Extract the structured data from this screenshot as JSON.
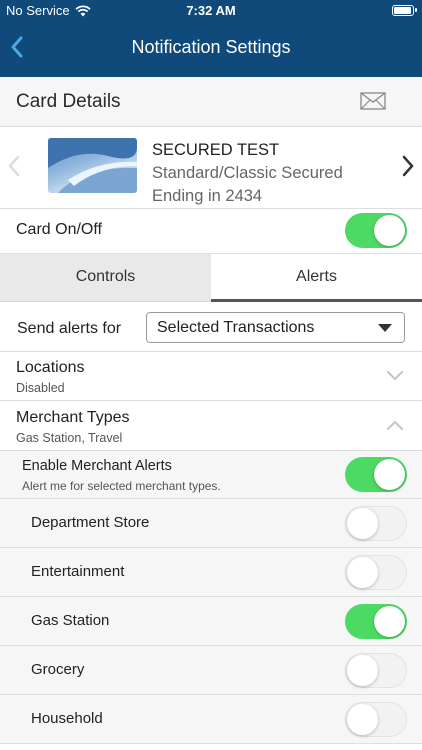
{
  "status_bar": {
    "carrier": "No Service",
    "time": "7:32 AM",
    "battery_level": 0.9
  },
  "nav": {
    "title": "Notification Settings"
  },
  "card_details": {
    "label": "Card Details"
  },
  "card": {
    "name": "SECURED TEST",
    "type": "Standard/Classic Secured",
    "ending": "Ending in 2434"
  },
  "card_on_off": {
    "label": "Card On/Off",
    "on": true
  },
  "tabs": [
    {
      "label": "Controls",
      "active": false
    },
    {
      "label": "Alerts",
      "active": true
    }
  ],
  "send_alerts": {
    "label": "Send alerts for",
    "selected": "Selected Transactions"
  },
  "locations": {
    "title": "Locations",
    "subtitle": "Disabled",
    "expanded": false
  },
  "merchant_types": {
    "title": "Merchant Types",
    "subtitle": "Gas Station, Travel",
    "expanded": true
  },
  "enable_merchant": {
    "title": "Enable Merchant Alerts",
    "subtitle": "Alert me for selected merchant types.",
    "on": true
  },
  "merchant_items": [
    {
      "label": "Department Store",
      "on": false
    },
    {
      "label": "Entertainment",
      "on": false
    },
    {
      "label": "Gas Station",
      "on": true
    },
    {
      "label": "Grocery",
      "on": false
    },
    {
      "label": "Household",
      "on": false
    }
  ],
  "colors": {
    "nav_bg": "#0f4a7a",
    "toggle_on": "#4cd964",
    "back_arrow": "#4aa8e8"
  }
}
